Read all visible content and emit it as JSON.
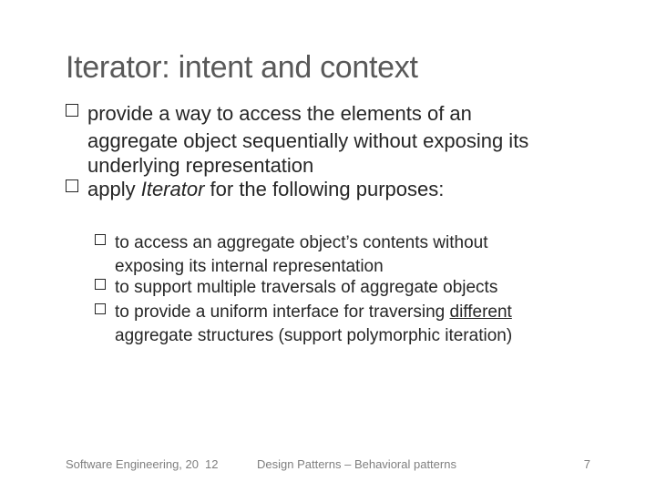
{
  "title": "Iterator: intent and context",
  "bullets": [
    {
      "lead": "provide a way to access the elements of an",
      "cont": "aggregate object sequentially without exposing its underlying representation"
    },
    {
      "lead_pre": "apply ",
      "lead_em": "Iterator",
      "lead_post": " for the following purposes:"
    }
  ],
  "sub_bullets": [
    {
      "a": "to access an aggregate object",
      "apos": "’",
      "b": "s contents without",
      "cont": "exposing its internal representation"
    },
    {
      "a": "to support multiple traversals of aggregate objects"
    },
    {
      "a": "to provide a uniform interface for traversing ",
      "u": "different",
      "cont": "aggregate structures (support polymorphic iteration)"
    }
  ],
  "footer": {
    "left": "Software Engineering, 20",
    "num": "12",
    "mid": "Design Patterns – Behavioral patterns",
    "right": "7"
  }
}
